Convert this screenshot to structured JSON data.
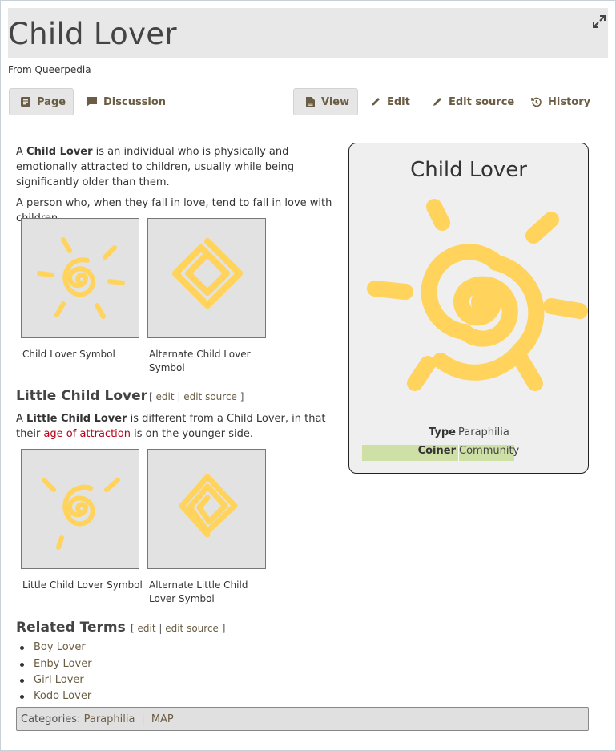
{
  "page": {
    "title": "Child Lover",
    "from": "From Queerpedia"
  },
  "tabs": {
    "page": "Page",
    "discussion": "Discussion",
    "view": "View",
    "edit": "Edit",
    "edit_source": "Edit source",
    "history": "History"
  },
  "intro": {
    "p1_pre": "A ",
    "p1_bold": "Child Lover",
    "p1_post": " is an individual who is physically and emotionally attracted to children, usually while being significantly older than them.",
    "p2": "A person who, when they fall in love, tend to fall in love with children."
  },
  "gallery1": [
    {
      "caption": "Child Lover Symbol"
    },
    {
      "caption": "Alternate Child Lover Symbol"
    }
  ],
  "section_little": {
    "heading": "Little Child Lover",
    "edit": "edit",
    "edit_source": "edit source",
    "p_pre": "A ",
    "p_bold": "Little Child Lover",
    "p_mid": " is different from a Child Lover, in that their ",
    "p_link": "age of attraction",
    "p_post": " is on the younger side."
  },
  "gallery2": [
    {
      "caption": "Little Child Lover Symbol"
    },
    {
      "caption": "Alternate Little Child Lover Symbol"
    }
  ],
  "section_related": {
    "heading": "Related Terms",
    "edit": "edit",
    "edit_source": "edit source",
    "items": [
      "Boy Lover",
      "Enby Lover",
      "Girl Lover",
      "Kodo Lover"
    ]
  },
  "categories": {
    "label": "Categories:",
    "items": [
      "Paraphilia",
      "MAP"
    ]
  },
  "infobox": {
    "title": "Child Lover",
    "rows": [
      {
        "key": "Type",
        "value": "Paraphilia"
      },
      {
        "key": "Coiner",
        "value": "Community"
      }
    ],
    "highlight_color": "#cfe0a6"
  },
  "colors": {
    "symbol_yellow": "#ffd35c",
    "link_brown": "#6b5d44",
    "link_red": "#b5001b"
  }
}
